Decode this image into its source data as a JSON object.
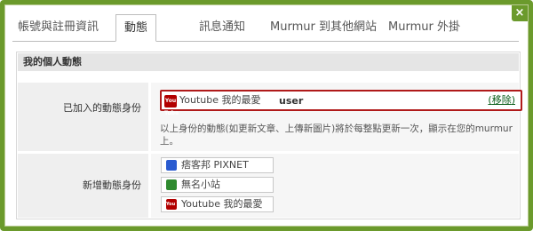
{
  "tabs": [
    {
      "label": "帳號與註冊資訊",
      "active": false
    },
    {
      "label": "動態",
      "active": true
    },
    {
      "label": "訊息通知",
      "active": false
    },
    {
      "label": "Murmur 到其他網站",
      "active": false
    },
    {
      "label": "Murmur 外掛",
      "active": false
    }
  ],
  "close_label": "×",
  "section": {
    "title": "我的個人動態"
  },
  "joined": {
    "label": "已加入的動態身份",
    "identity": {
      "icon": "youtube-icon",
      "icon_text": "You Tube",
      "name": "Youtube 我的最愛",
      "user_value": "user",
      "remove_label": "移除"
    },
    "note": "以上身份的動態(如更新文章、上傳新圖片)將於每整點更新一次，顯示在您的murmur 上。"
  },
  "add": {
    "label": "新增動態身份",
    "options": [
      {
        "icon": "pixnet-icon",
        "label": "痞客邦 PIXNET"
      },
      {
        "icon": "site-icon",
        "label": "無名小站"
      },
      {
        "icon": "youtube-icon",
        "label": "Youtube 我的最愛"
      }
    ]
  },
  "colors": {
    "frame": "#6b9a2c",
    "highlight_border": "#b01a1a",
    "remove_link": "#0b5e1a"
  }
}
